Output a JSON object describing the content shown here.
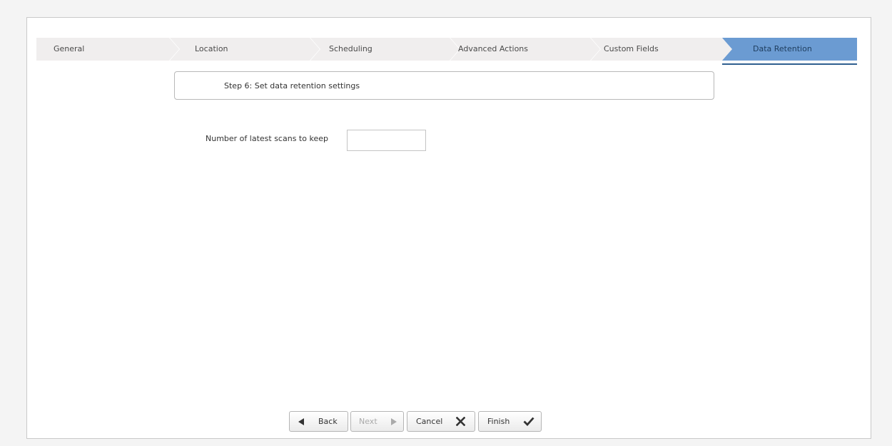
{
  "wizard": {
    "steps": [
      {
        "label": "General"
      },
      {
        "label": "Location"
      },
      {
        "label": "Scheduling"
      },
      {
        "label": "Advanced Actions"
      },
      {
        "label": "Custom Fields"
      },
      {
        "label": "Data Retention",
        "active": true
      }
    ],
    "step_heading": "Step 6: Set data retention settings"
  },
  "form": {
    "scans_label": "Number of latest scans to keep",
    "scans_value": ""
  },
  "footer": {
    "back_label": "Back",
    "next_label": "Next",
    "cancel_label": "Cancel",
    "finish_label": "Finish"
  },
  "colors": {
    "active_step": "#6b9bd2",
    "inactive_step": "#f0eeee",
    "active_underline": "#2f5f8f"
  },
  "icons": {
    "back": "triangle-left-icon",
    "next": "triangle-right-icon",
    "cancel": "x-icon",
    "finish": "checkmark-icon"
  }
}
